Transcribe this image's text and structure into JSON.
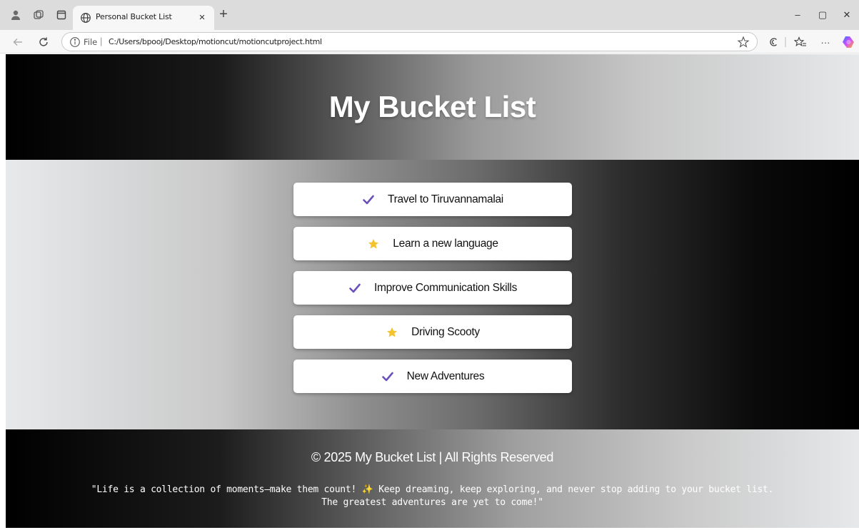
{
  "browser": {
    "tab_title": "Personal Bucket List",
    "tab_close": "×",
    "new_tab": "+",
    "url_scheme": "File",
    "url_separator": "|",
    "url": "C:/Users/bpooj/Desktop/motioncut/motioncutproject.html",
    "window_controls": {
      "minimize": "–",
      "maximize": "▢",
      "close": "✕"
    },
    "more": "···"
  },
  "page": {
    "title": "My Bucket List",
    "items": [
      {
        "icon": "checkmark-icon",
        "text": "Travel to Tiruvannamalai"
      },
      {
        "icon": "star-icon",
        "text": "Learn a new language"
      },
      {
        "icon": "checkmark-icon",
        "text": "Improve Communication Skills"
      },
      {
        "icon": "star-icon",
        "text": "Driving Scooty"
      },
      {
        "icon": "checkmark-icon",
        "text": "New Adventures"
      }
    ],
    "footer": {
      "copyright": "© 2025 My Bucket List | All Rights Reserved",
      "quote_line1": "\"Life is a collection of moments—make them count! ✨ Keep dreaming, keep exploring, and never stop adding to your bucket list.",
      "quote_line2": "The greatest adventures are yet to come!\""
    }
  },
  "colors": {
    "check": "#6b4fbb",
    "star": "#f4c430",
    "text": "#111111"
  }
}
